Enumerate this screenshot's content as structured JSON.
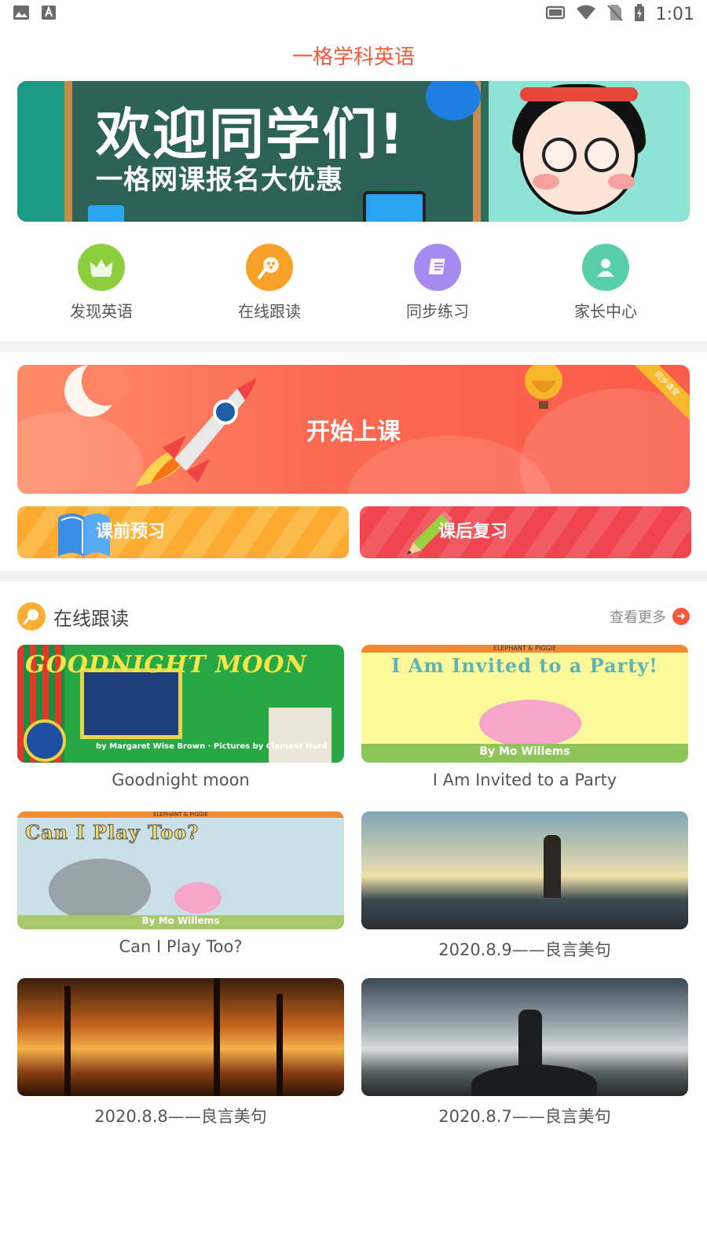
{
  "status_bar": {
    "left_icons": [
      "image-icon",
      "text-a-icon"
    ],
    "right_icons": [
      "cast-icon",
      "wifi-icon",
      "no-sim-icon",
      "battery-icon"
    ],
    "time": "1:01"
  },
  "app": {
    "title": "一格学科英语"
  },
  "banner": {
    "headline": "欢迎同学们!",
    "subline": "一格网课报名大优惠"
  },
  "quick_nav": [
    {
      "label": "发现英语",
      "icon": "crown-icon",
      "color": "#8ccf3e"
    },
    {
      "label": "在线跟读",
      "icon": "microphone-icon",
      "color": "#f7a129"
    },
    {
      "label": "同步练习",
      "icon": "notebook-icon",
      "color": "#a58bf0"
    },
    {
      "label": "家长中心",
      "icon": "user-icon",
      "color": "#58cfa9"
    }
  ],
  "start_class": {
    "label": "开始上课",
    "ribbon": "同步课堂"
  },
  "sub_buttons": {
    "preview": "课前预习",
    "review": "课后复习"
  },
  "section": {
    "title": "在线跟读",
    "more": "查看更多"
  },
  "readings": [
    {
      "caption": "Goodnight moon",
      "cover_title": "GOODNIGHT MOON",
      "cover_credit": "by Margaret Wise Brown · Pictures by Clement Hurd"
    },
    {
      "caption": "I Am Invited to a Party",
      "cover_title": "I Am Invited to a Party!",
      "cover_series": "ELEPHANT & PIGGIE",
      "cover_credit": "By Mo Willems"
    },
    {
      "caption": "Can I Play Too?",
      "cover_title": "Can I Play Too?",
      "cover_series": "ELEPHANT & PIGGIE",
      "cover_credit": "By Mo Willems"
    },
    {
      "caption": "2020.8.9——良言美句"
    },
    {
      "caption": "2020.8.8——良言美句"
    },
    {
      "caption": "2020.8.7——良言美句"
    }
  ],
  "colors": {
    "brand": "#f05a3c",
    "divider": "#f2f2f2"
  }
}
